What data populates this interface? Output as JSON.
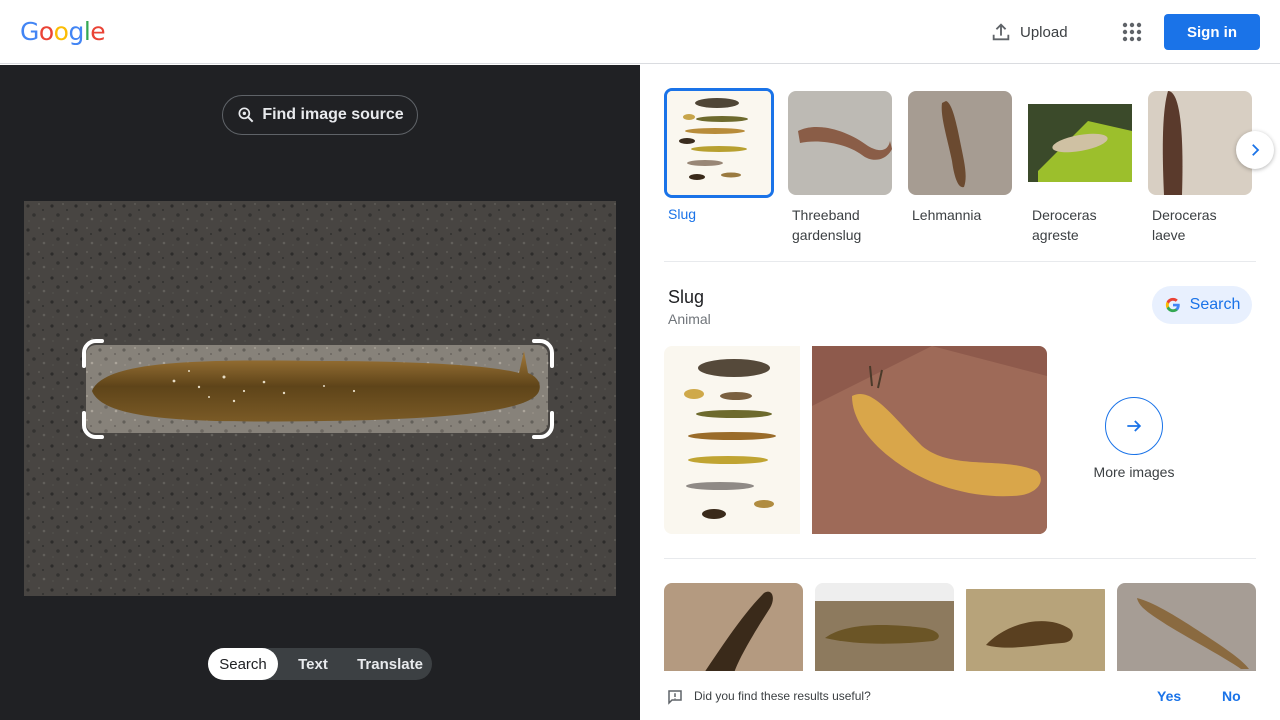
{
  "header": {
    "logo": [
      "G",
      "o",
      "o",
      "g",
      "l",
      "e"
    ],
    "logo_colors": [
      "#4285f4",
      "#ea4335",
      "#fbbc05",
      "#4285f4",
      "#34a853",
      "#ea4335"
    ],
    "upload_label": "Upload",
    "apps_icon": "apps-grid-icon",
    "signin_label": "Sign in"
  },
  "lens": {
    "find_source_label": "Find image source",
    "modes": [
      "Search",
      "Text",
      "Translate"
    ],
    "active_mode": "Search"
  },
  "related": [
    {
      "label": "Slug",
      "selected": true
    },
    {
      "label": "Threeband gardenslug",
      "selected": false
    },
    {
      "label": "Lehmannia",
      "selected": false
    },
    {
      "label": "Deroceras agreste",
      "selected": false
    },
    {
      "label": "Deroceras laeve",
      "selected": false
    }
  ],
  "entity": {
    "title": "Slug",
    "subtitle": "Animal",
    "search_label": "Search",
    "more_label": "More images"
  },
  "feedback": {
    "question": "Did you find these results useful?",
    "yes": "Yes",
    "no": "No"
  },
  "colors": {
    "accent": "#1a73e8",
    "dark_panel": "#202124"
  }
}
